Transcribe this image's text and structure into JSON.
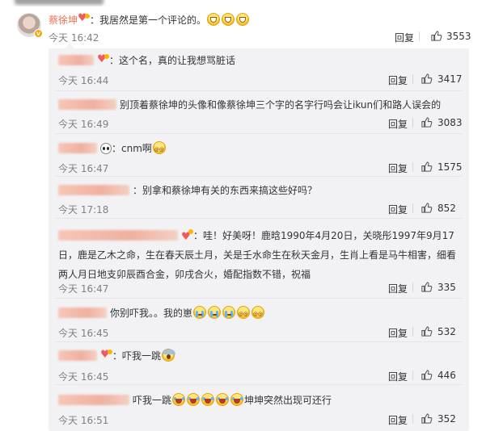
{
  "main_comment": {
    "username": "蔡徐坤",
    "text": "：我居然是第一个评论的。",
    "time": "今天 16:42",
    "reply_label": "回复",
    "likes": "3553",
    "emojis": [
      "grin-emoji",
      "grin-emoji",
      "grin-emoji"
    ]
  },
  "replies": [
    {
      "text": "：这个名，真的让我想骂脏话",
      "time": "今天 16:44",
      "reply_label": "回复",
      "likes": "3417"
    },
    {
      "text": "别顶着蔡徐坤的头像和像蔡徐坤三个字的名字行吗会让ikun们和路人误会的",
      "time": "今天 16:49",
      "reply_label": "回复",
      "likes": "3083"
    },
    {
      "text": "：cnm啊",
      "time": "今天 16:47",
      "reply_label": "回复",
      "likes": "1575"
    },
    {
      "text": "：别拿和蔡徐坤有关的东西来搞这些好吗？",
      "time": "今天 17:18",
      "reply_label": "回复",
      "likes": "852"
    },
    {
      "text_line1": "：哇！好美呀！鹿晗1990年4月20日，关晓彤1997年9月17",
      "text_line2": "日，鹿是乙木之命，生在春天辰土月，关是壬水命生在秋天金月，生肖上看是马牛相害，细看",
      "text_line3": "两人月日地支卯辰酉合金，卯戌合火，婚配指数不错，祝福",
      "time": "今天 16:47",
      "reply_label": "回复",
      "likes": "335"
    },
    {
      "text": "你别吓我。。我的崽",
      "time": "今天 16:45",
      "reply_label": "回复",
      "likes": "532"
    },
    {
      "text": "：吓我一跳",
      "time": "今天 16:45",
      "reply_label": "回复",
      "likes": "446"
    },
    {
      "text_before": "吓我一跳",
      "text_after": "坤坤突然出现可还行",
      "time": "今天 16:51",
      "reply_label": "回复",
      "likes": "352"
    }
  ],
  "icons": {
    "like": "thumbs-up-icon",
    "verified": "verified-badge-icon",
    "member": "heart-member-icon"
  },
  "colors": {
    "username": "#eb7350",
    "time": "#808080",
    "reply_bg": "#f2f2f5"
  }
}
